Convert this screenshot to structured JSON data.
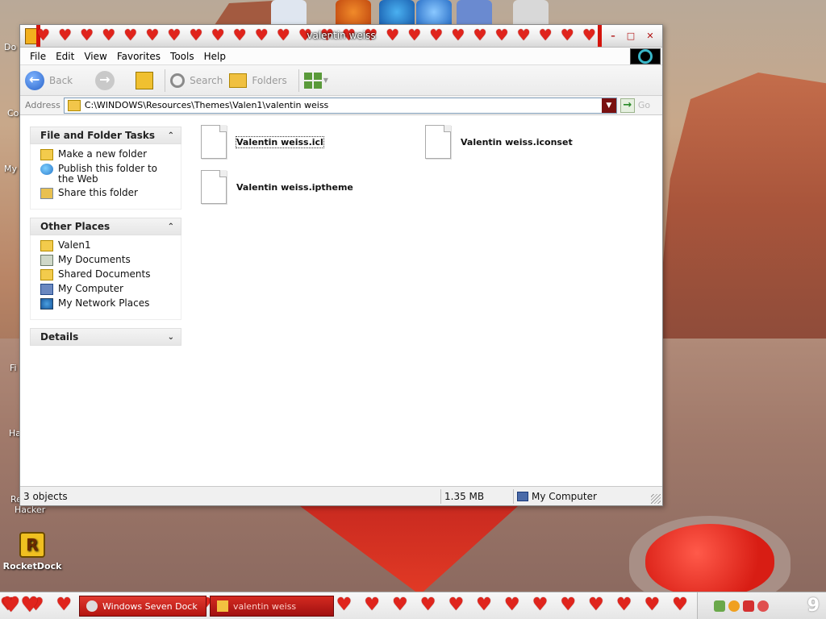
{
  "desktop": {
    "icons": [
      {
        "label": "RocketDock",
        "name": "rocketdock-icon"
      }
    ],
    "edge_labels": [
      "Do",
      "Co",
      "My",
      "Fi",
      "Ha",
      "Re",
      "Hacker"
    ]
  },
  "window": {
    "title": "valentin weiss",
    "menu": [
      "File",
      "Edit",
      "View",
      "Favorites",
      "Tools",
      "Help"
    ],
    "toolbar": {
      "back": "Back",
      "search": "Search",
      "folders": "Folders"
    },
    "address": {
      "label": "Address",
      "path": "C:\\WINDOWS\\Resources\\Themes\\Valen1\\valentin weiss",
      "go": "Go"
    },
    "tasks_panel": {
      "title": "File and Folder Tasks",
      "items": [
        "Make a new folder",
        "Publish this folder to the Web",
        "Share this folder"
      ]
    },
    "places_panel": {
      "title": "Other Places",
      "items": [
        "Valen1",
        "My Documents",
        "Shared Documents",
        "My Computer",
        "My Network Places"
      ]
    },
    "details_panel": {
      "title": "Details"
    },
    "files": [
      {
        "name": "Valentin weiss.icl",
        "selected": true
      },
      {
        "name": "Valentin weiss.iconset",
        "selected": false
      },
      {
        "name": "Valentin weiss.iptheme",
        "selected": false
      }
    ],
    "status": {
      "objects": "3 objects",
      "size": "1.35 MB",
      "location": "My Computer"
    }
  },
  "taskbar": {
    "tasks": [
      {
        "label": "Windows Seven Dock",
        "active": false
      },
      {
        "label": "valentin weiss",
        "active": true
      }
    ],
    "clock": "9"
  },
  "colors": {
    "accent_red": "#d4140c",
    "heart_red": "#e0241c",
    "link_blue": "#2a64c9"
  }
}
